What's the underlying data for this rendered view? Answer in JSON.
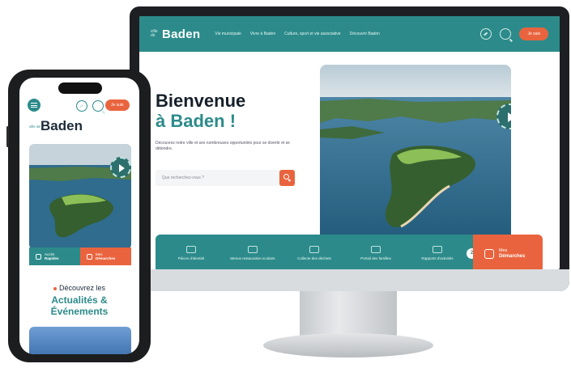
{
  "desktop": {
    "logo_small": "ville de",
    "logo_name": "Baden",
    "menu": [
      "Vie municipale",
      "Vivre à Baden",
      "Culture, sport et vie associative",
      "Découvrir Baden"
    ],
    "cta": "Je suis",
    "title_line1": "Bienvenue",
    "title_line2": "à Baden !",
    "description": "Découvrez notre ville et ses nombreuses opportunités pour se divertir et se détendre.",
    "search_placeholder": "Que recherchez-vous ?",
    "quick_links": [
      "Pièces d'identité",
      "Menus restauration scolaire",
      "Collecte des déchets",
      "Portail des familles",
      "Rapports d'activités"
    ],
    "badge": "2",
    "demarches_line1": "Mes",
    "demarches_line2": "Démarches"
  },
  "phone": {
    "cta": "Je suis",
    "logo_small": "ville de",
    "logo_name": "Baden",
    "quick_line1": "Accès",
    "quick_line2": "Rapides",
    "demarches_line1": "Mes",
    "demarches_line2": "Démarches",
    "discover": "Découvrez les",
    "section_title_1": "Actualités &",
    "section_title_2": "Événements"
  },
  "colors": {
    "teal": "#2c8b8a",
    "orange": "#e9643e",
    "navy": "#1d2b3a"
  }
}
